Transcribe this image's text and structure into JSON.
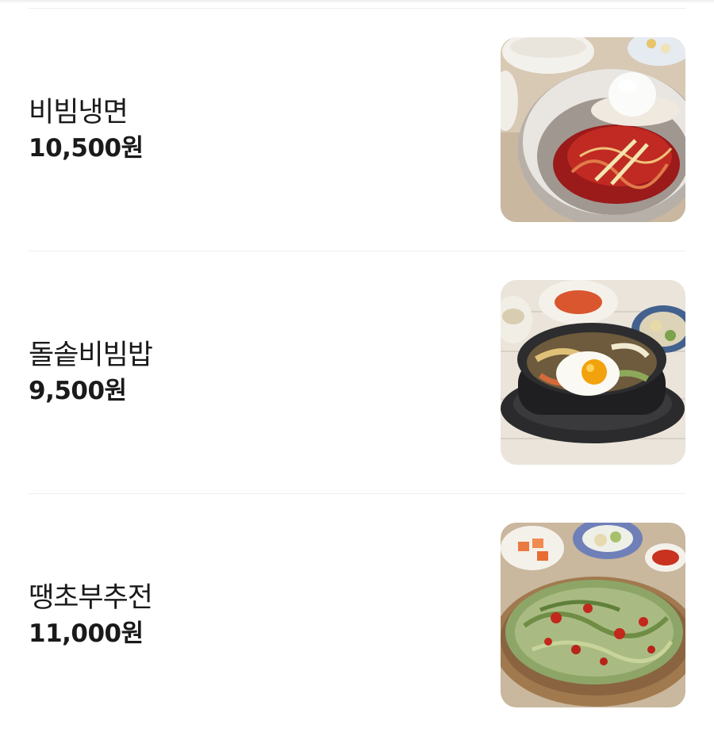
{
  "menu": {
    "items": [
      {
        "name": "비빔냉면",
        "price": "10,500원",
        "photo": "bibim-naengmyeon-photo"
      },
      {
        "name": "돌솥비빔밥",
        "price": "9,500원",
        "photo": "dolsot-bibimbap-photo"
      },
      {
        "name": "땡초부추전",
        "price": "11,000원",
        "photo": "ttaengcho-buchujeon-photo"
      }
    ]
  },
  "colors": {
    "text": "#1a1a1a",
    "divider": "#eeeeee",
    "background": "#ffffff"
  }
}
